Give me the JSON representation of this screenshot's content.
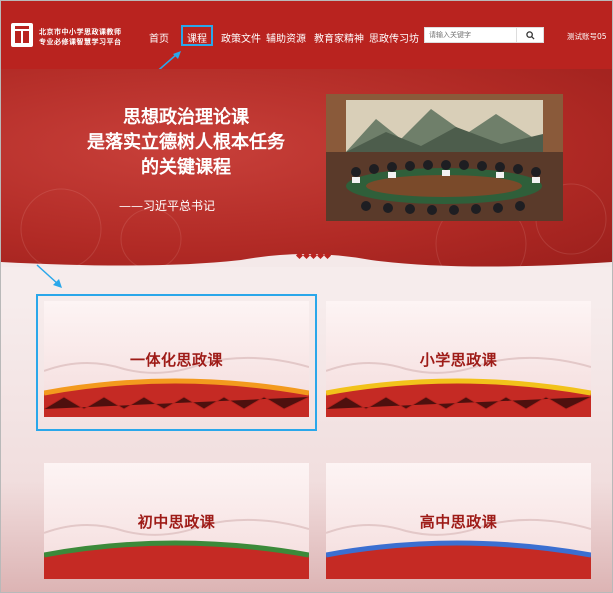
{
  "header": {
    "logo_line1": "北京市中小学思政课教师",
    "logo_line2": "专业必修课智慧学习平台",
    "nav": [
      {
        "label": "首页"
      },
      {
        "label": "课程"
      },
      {
        "label": "政策文件"
      },
      {
        "label": "辅助资源"
      },
      {
        "label": "教育家精神"
      },
      {
        "label": "思政传习坊"
      }
    ],
    "search_placeholder": "请输入关键字",
    "account": "测试账号05"
  },
  "banner": {
    "quote_lines": [
      "思想政治理论课",
      "是落实立德树人根本任务",
      "的关键课程"
    ],
    "author": "——习近平总书记"
  },
  "courses": [
    {
      "title": "一体化思政课",
      "accent": "#f39a1e"
    },
    {
      "title": "小学思政课",
      "accent": "#f2c21b"
    },
    {
      "title": "初中思政课",
      "accent": "#3c8a3a"
    },
    {
      "title": "高中思政课",
      "accent": "#3b6fd1"
    }
  ],
  "colors": {
    "brand": "#b9231f",
    "highlight": "#2aa7ea"
  }
}
